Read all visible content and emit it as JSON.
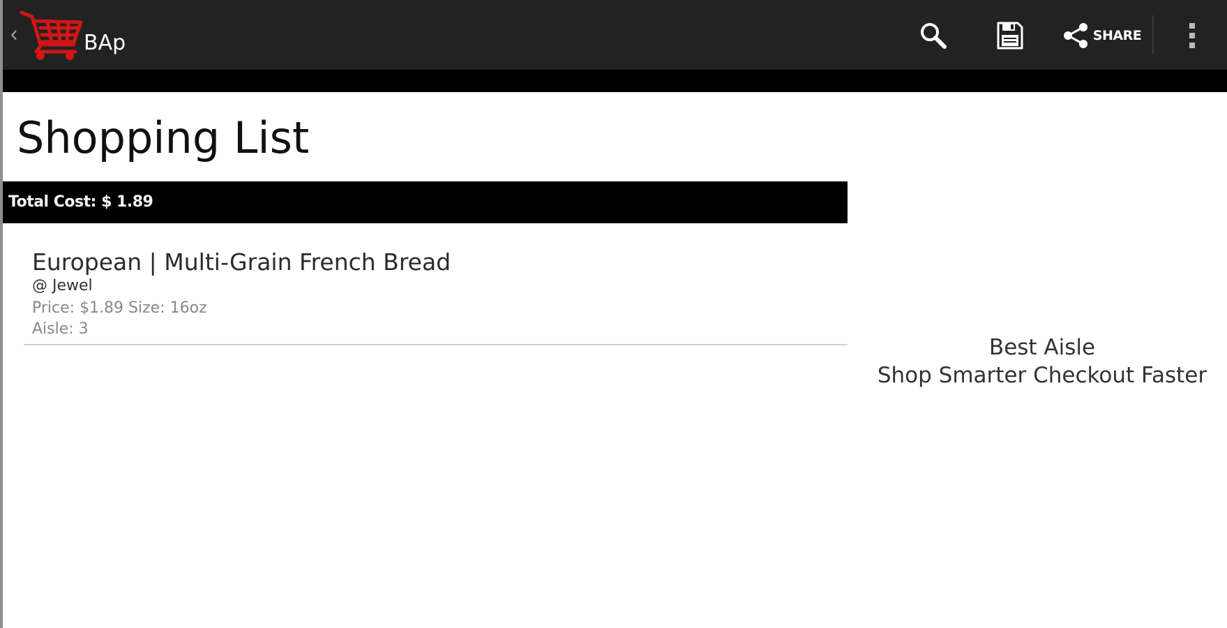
{
  "action_bar": {
    "app_title": "BAp",
    "brand_color": "#d21515",
    "background_color": "#222222",
    "actions": [
      {
        "id": "search",
        "icon": "search-icon"
      },
      {
        "id": "save",
        "icon": "save-icon"
      },
      {
        "id": "share",
        "icon": "share-icon",
        "label": "SHARE"
      },
      {
        "id": "overflow",
        "icon": "overflow-menu-icon"
      }
    ]
  },
  "main": {
    "title": "Shopping List",
    "total_cost_label": "Total Cost: $ 1.89",
    "items": [
      {
        "name": "European | Multi-Grain French Bread",
        "store": "@ Jewel",
        "price_size": "Price: $1.89 Size: 16oz",
        "aisle": "Aisle: 3"
      }
    ]
  },
  "promo": {
    "title": "Best Aisle",
    "tagline": "Shop Smarter Checkout Faster"
  }
}
